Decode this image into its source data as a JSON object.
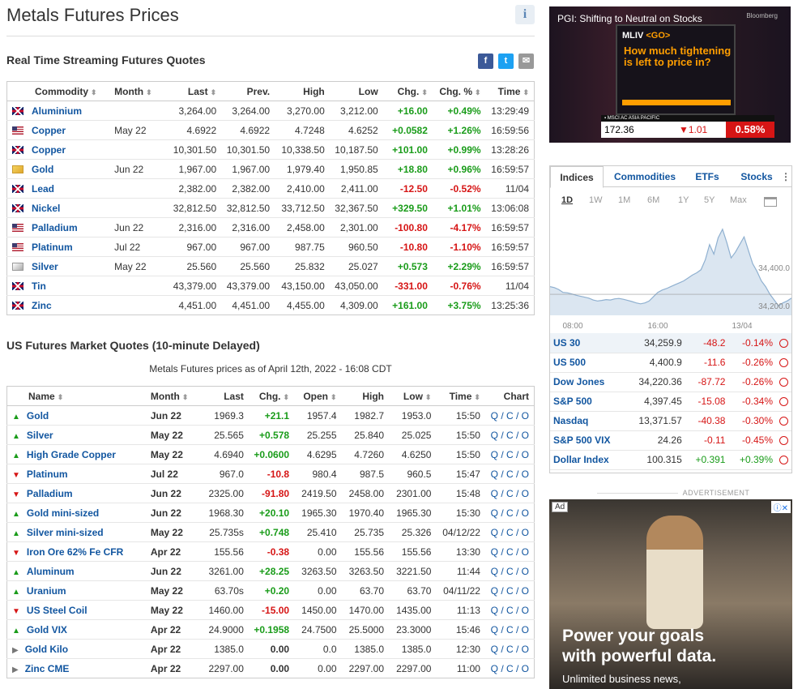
{
  "page": {
    "title": "Metals Futures Prices",
    "info_icon": "i",
    "rt_heading": "Real Time Streaming Futures Quotes",
    "us_heading": "US Futures Market Quotes (10-minute Delayed)",
    "asof": "Metals Futures prices as of April 12th, 2022 - 16:08 CDT"
  },
  "social": {
    "facebook": "f",
    "twitter": "t",
    "email": "✉"
  },
  "rt": {
    "headers": [
      "Commodity",
      "Month",
      "Last",
      "Prev.",
      "High",
      "Low",
      "Chg.",
      "Chg. %",
      "Time"
    ],
    "rows": [
      {
        "flag": "uk",
        "name": "Aluminium",
        "month": "",
        "last": "3,264.00",
        "prev": "3,264.00",
        "high": "3,270.00",
        "low": "3,212.00",
        "chg": "+16.00",
        "pct": "+0.49%",
        "time": "13:29:49",
        "dir": "pos"
      },
      {
        "flag": "us",
        "name": "Copper",
        "month": "May 22",
        "last": "4.6922",
        "prev": "4.6922",
        "high": "4.7248",
        "low": "4.6252",
        "chg": "+0.0582",
        "pct": "+1.26%",
        "time": "16:59:56",
        "dir": "pos"
      },
      {
        "flag": "uk",
        "name": "Copper",
        "month": "",
        "last": "10,301.50",
        "prev": "10,301.50",
        "high": "10,338.50",
        "low": "10,187.50",
        "chg": "+101.00",
        "pct": "+0.99%",
        "time": "13:28:26",
        "dir": "pos"
      },
      {
        "flag": "gold",
        "name": "Gold",
        "month": "Jun 22",
        "last": "1,967.00",
        "prev": "1,967.00",
        "high": "1,979.40",
        "low": "1,950.85",
        "chg": "+18.80",
        "pct": "+0.96%",
        "time": "16:59:57",
        "dir": "pos"
      },
      {
        "flag": "uk",
        "name": "Lead",
        "month": "",
        "last": "2,382.00",
        "prev": "2,382.00",
        "high": "2,410.00",
        "low": "2,411.00",
        "chg": "-12.50",
        "pct": "-0.52%",
        "time": "11/04",
        "dir": "neg"
      },
      {
        "flag": "uk",
        "name": "Nickel",
        "month": "",
        "last": "32,812.50",
        "prev": "32,812.50",
        "high": "33,712.50",
        "low": "32,367.50",
        "chg": "+329.50",
        "pct": "+1.01%",
        "time": "13:06:08",
        "dir": "pos"
      },
      {
        "flag": "us",
        "name": "Palladium",
        "month": "Jun 22",
        "last": "2,316.00",
        "prev": "2,316.00",
        "high": "2,458.00",
        "low": "2,301.00",
        "chg": "-100.80",
        "pct": "-4.17%",
        "time": "16:59:57",
        "dir": "neg"
      },
      {
        "flag": "us",
        "name": "Platinum",
        "month": "Jul 22",
        "last": "967.00",
        "prev": "967.00",
        "high": "987.75",
        "low": "960.50",
        "chg": "-10.80",
        "pct": "-1.10%",
        "time": "16:59:57",
        "dir": "neg"
      },
      {
        "flag": "silver",
        "name": "Silver",
        "month": "May 22",
        "last": "25.560",
        "prev": "25.560",
        "high": "25.832",
        "low": "25.027",
        "chg": "+0.573",
        "pct": "+2.29%",
        "time": "16:59:57",
        "dir": "pos"
      },
      {
        "flag": "uk",
        "name": "Tin",
        "month": "",
        "last": "43,379.00",
        "prev": "43,379.00",
        "high": "43,150.00",
        "low": "43,050.00",
        "chg": "-331.00",
        "pct": "-0.76%",
        "time": "11/04",
        "dir": "neg"
      },
      {
        "flag": "uk",
        "name": "Zinc",
        "month": "",
        "last": "4,451.00",
        "prev": "4,451.00",
        "high": "4,455.00",
        "low": "4,309.00",
        "chg": "+161.00",
        "pct": "+3.75%",
        "time": "13:25:36",
        "dir": "pos"
      }
    ]
  },
  "us": {
    "headers": [
      "Name",
      "Month",
      "Last",
      "Chg.",
      "Open",
      "High",
      "Low",
      "Time",
      "Chart"
    ],
    "rows": [
      {
        "name": "Gold",
        "month": "Jun 22",
        "last": "1969.3",
        "chg": "+21.1",
        "open": "1957.4",
        "high": "1982.7",
        "low": "1953.0",
        "time": "15:50",
        "dir": "pos"
      },
      {
        "name": "Silver",
        "month": "May 22",
        "last": "25.565",
        "chg": "+0.578",
        "open": "25.255",
        "high": "25.840",
        "low": "25.025",
        "time": "15:50",
        "dir": "pos"
      },
      {
        "name": "High Grade Copper",
        "month": "May 22",
        "last": "4.6940",
        "chg": "+0.0600",
        "open": "4.6295",
        "high": "4.7260",
        "low": "4.6250",
        "time": "15:50",
        "dir": "pos"
      },
      {
        "name": "Platinum",
        "month": "Jul 22",
        "last": "967.0",
        "chg": "-10.8",
        "open": "980.4",
        "high": "987.5",
        "low": "960.5",
        "time": "15:47",
        "dir": "neg"
      },
      {
        "name": "Palladium",
        "month": "Jun 22",
        "last": "2325.00",
        "chg": "-91.80",
        "open": "2419.50",
        "high": "2458.00",
        "low": "2301.00",
        "time": "15:48",
        "dir": "neg"
      },
      {
        "name": "Gold mini-sized",
        "month": "Jun 22",
        "last": "1968.30",
        "chg": "+20.10",
        "open": "1965.30",
        "high": "1970.40",
        "low": "1965.30",
        "time": "15:30",
        "dir": "pos"
      },
      {
        "name": "Silver mini-sized",
        "month": "May 22",
        "last": "25.735s",
        "chg": "+0.748",
        "open": "25.410",
        "high": "25.735",
        "low": "25.326",
        "time": "04/12/22",
        "dir": "pos"
      },
      {
        "name": "Iron Ore 62% Fe CFR",
        "month": "Apr 22",
        "last": "155.56",
        "chg": "-0.38",
        "open": "0.00",
        "high": "155.56",
        "low": "155.56",
        "time": "13:30",
        "dir": "neg"
      },
      {
        "name": "Aluminum",
        "month": "Jun 22",
        "last": "3261.00",
        "chg": "+28.25",
        "open": "3263.50",
        "high": "3263.50",
        "low": "3221.50",
        "time": "11:44",
        "dir": "pos"
      },
      {
        "name": "Uranium",
        "month": "May 22",
        "last": "63.70s",
        "chg": "+0.20",
        "open": "0.00",
        "high": "63.70",
        "low": "63.70",
        "time": "04/11/22",
        "dir": "pos"
      },
      {
        "name": "US Steel Coil",
        "month": "May 22",
        "last": "1460.00",
        "chg": "-15.00",
        "open": "1450.00",
        "high": "1470.00",
        "low": "1435.00",
        "time": "11:13",
        "dir": "neg"
      },
      {
        "name": "Gold VIX",
        "month": "Apr 22",
        "last": "24.9000",
        "chg": "+0.1958",
        "open": "24.7500",
        "high": "25.5000",
        "low": "23.3000",
        "time": "15:46",
        "dir": "pos"
      },
      {
        "name": "Gold Kilo",
        "month": "Apr 22",
        "last": "1385.0",
        "chg": "0.00",
        "open": "0.0",
        "high": "1385.0",
        "low": "1385.0",
        "time": "12:30",
        "dir": "nt"
      },
      {
        "name": "Zinc CME",
        "month": "Apr 22",
        "last": "2297.00",
        "chg": "0.00",
        "open": "0.00",
        "high": "2297.00",
        "low": "2297.00",
        "time": "11:00",
        "dir": "nt"
      }
    ],
    "chart_links": "Q / C / O"
  },
  "video": {
    "title": "PGI: Shifting to Neutral on Stocks",
    "brand": "Bloomberg",
    "mliv": "MLIV",
    "go": "<GO>",
    "question": "How much tightening is left to price in?",
    "ticker_label": "▪ MSCI AC ASIA PACIFIC",
    "ticker_value": "172.36",
    "ticker_change": "▼1.01",
    "ticker_pct": "0.58%"
  },
  "widget": {
    "tabs": [
      "Indices",
      "Commodities",
      "ETFs",
      "Stocks"
    ],
    "more": "⋮",
    "ranges": [
      "1D",
      "1W",
      "1M",
      "6M",
      "1Y",
      "5Y",
      "Max"
    ],
    "chart_data": {
      "type": "area",
      "x_ticks": [
        "08:00",
        "16:00",
        "13/04"
      ],
      "y_ticks": [
        "34,400.0",
        "34,200.0"
      ],
      "values": [
        34300,
        34295,
        34285,
        34270,
        34268,
        34262,
        34255,
        34250,
        34245,
        34240,
        34230,
        34225,
        34228,
        34232,
        34230,
        34236,
        34238,
        34234,
        34228,
        34222,
        34215,
        34210,
        34215,
        34225,
        34248,
        34270,
        34282,
        34290,
        34300,
        34310,
        34320,
        34330,
        34345,
        34360,
        34372,
        34388,
        34440,
        34520,
        34470,
        34555,
        34600,
        34530,
        34450,
        34480,
        34520,
        34560,
        34490,
        34420,
        34380,
        34330,
        34300,
        34260,
        34230,
        34200,
        34215,
        34225,
        34240
      ],
      "baseline": 34259.9,
      "ylim": [
        34150,
        34650
      ]
    },
    "indices": [
      {
        "name": "US 30",
        "last": "34,259.9",
        "chg": "-48.2",
        "pct": "-0.14%",
        "dir": "neg"
      },
      {
        "name": "US 500",
        "last": "4,400.9",
        "chg": "-11.6",
        "pct": "-0.26%",
        "dir": "neg"
      },
      {
        "name": "Dow Jones",
        "last": "34,220.36",
        "chg": "-87.72",
        "pct": "-0.26%",
        "dir": "neg"
      },
      {
        "name": "S&P 500",
        "last": "4,397.45",
        "chg": "-15.08",
        "pct": "-0.34%",
        "dir": "neg"
      },
      {
        "name": "Nasdaq",
        "last": "13,371.57",
        "chg": "-40.38",
        "pct": "-0.30%",
        "dir": "neg"
      },
      {
        "name": "S&P 500 VIX",
        "last": "24.26",
        "chg": "-0.11",
        "pct": "-0.45%",
        "dir": "neg"
      },
      {
        "name": "Dollar Index",
        "last": "100.315",
        "chg": "+0.391",
        "pct": "+0.39%",
        "dir": "pos"
      }
    ]
  },
  "ad": {
    "label": "ADVERTISEMENT",
    "tag": "Ad",
    "close": "ⓘ✕",
    "headline1": "Power your goals",
    "headline2": "with powerful data.",
    "sub": "Unlimited business news,"
  }
}
